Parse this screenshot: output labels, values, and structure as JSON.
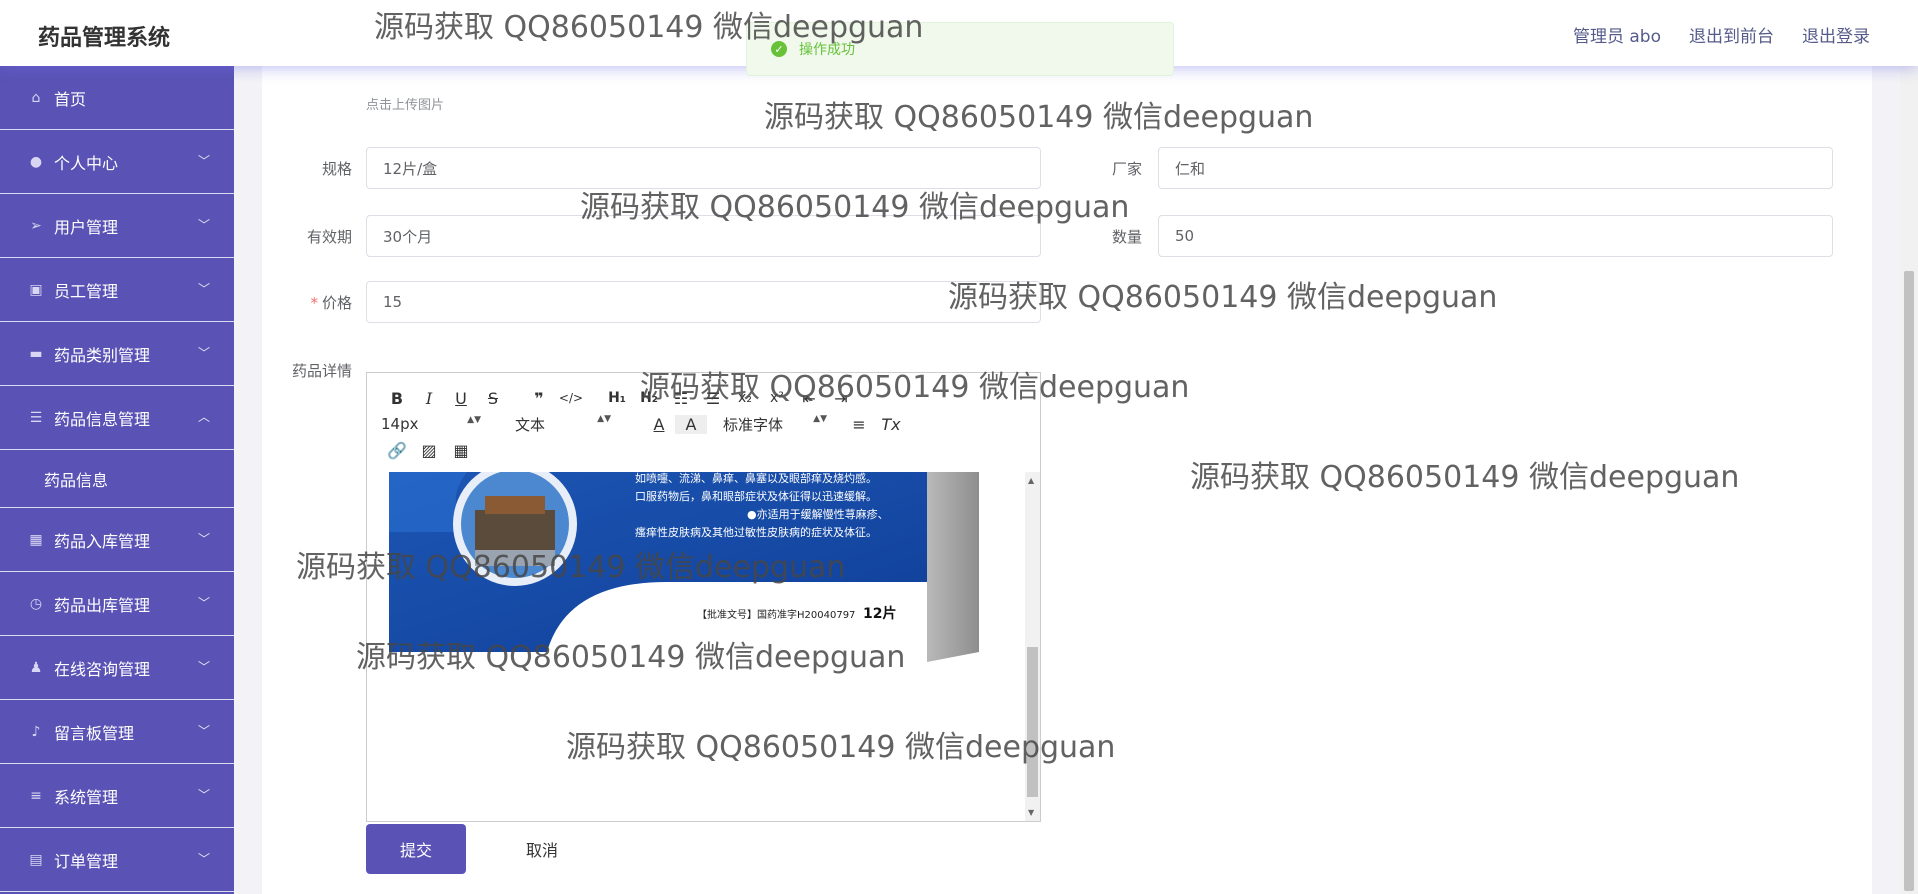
{
  "header": {
    "brand": "药品管理系统",
    "admin_label": "管理员 abo",
    "front_link": "退出到前台",
    "logout_link": "退出登录"
  },
  "toast": {
    "message": "操作成功",
    "color": "#67c23a"
  },
  "sidebar": {
    "accent": "#5a53b5",
    "items": [
      {
        "label": "首页",
        "icon": "home-icon"
      },
      {
        "label": "个人中心",
        "icon": "user-icon"
      },
      {
        "label": "用户管理",
        "icon": "send-icon"
      },
      {
        "label": "员工管理",
        "icon": "briefcase-icon"
      },
      {
        "label": "药品类别管理",
        "icon": "chat-icon"
      },
      {
        "label": "药品信息管理",
        "icon": "sliders-icon"
      },
      {
        "label": "药品入库管理",
        "icon": "grid-icon"
      },
      {
        "label": "药品出库管理",
        "icon": "clock-icon"
      },
      {
        "label": "在线咨询管理",
        "icon": "person-icon"
      },
      {
        "label": "留言板管理",
        "icon": "mic-icon"
      },
      {
        "label": "系统管理",
        "icon": "list-icon"
      },
      {
        "label": "订单管理",
        "icon": "clipboard-icon"
      }
    ],
    "sub_item": "药品信息"
  },
  "form": {
    "upload_tip": "点击上传图片",
    "spec_label": "规格",
    "spec_value": "12片/盒",
    "maker_label": "厂家",
    "maker_value": "仁和",
    "expiry_label": "有效期",
    "expiry_value": "30个月",
    "qty_label": "数量",
    "qty_value": "50",
    "price_label": "价格",
    "price_value": "15",
    "detail_label": "药品详情",
    "submit": "提交",
    "cancel": "取消"
  },
  "editor": {
    "font_size": "14px",
    "header_select": "文本",
    "font_family": "标准字体",
    "image_lines": [
      "如喷嚏、流涕、鼻痒、鼻塞以及眼部痒及烧灼感。",
      "口服药物后，鼻和眼部症状及体征得以迅速缓解。",
      "●亦适用于缓解慢性荨麻疹、",
      "瘙痒性皮肤病及其他过敏性皮肤病的症状及体征。"
    ],
    "approval_text": "【批准文号】国药准字H20040797",
    "count_text": "12片"
  },
  "watermark": "源码获取 QQ86050149 微信deepguan"
}
